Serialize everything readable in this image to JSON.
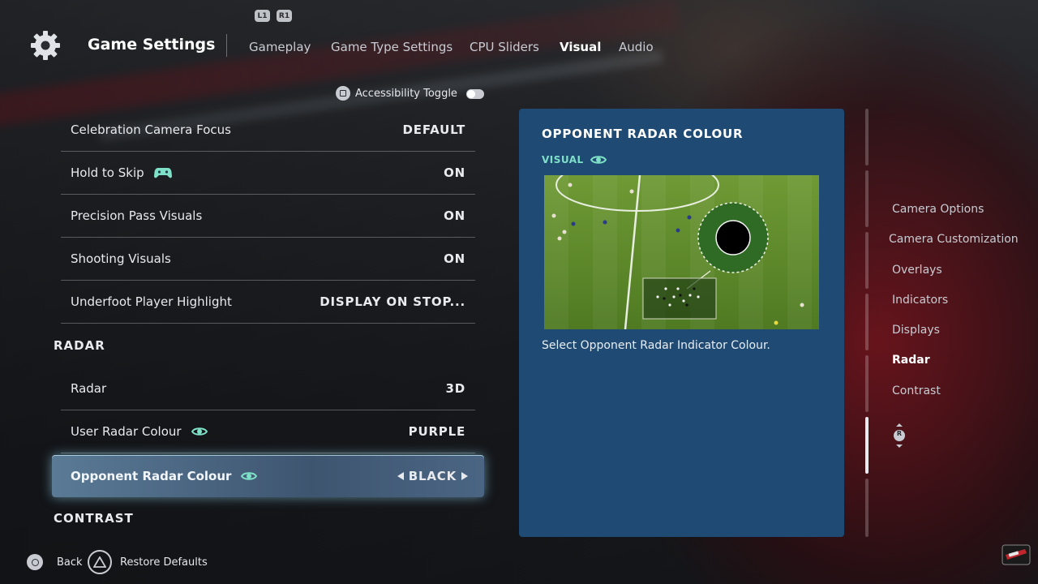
{
  "header": {
    "title": "Game Settings",
    "bumper_left": "L1",
    "bumper_right": "R1",
    "tabs": [
      {
        "label": "Gameplay",
        "active": false
      },
      {
        "label": "Game Type Settings",
        "active": false
      },
      {
        "label": "CPU Sliders",
        "active": false
      },
      {
        "label": "Visual",
        "active": true
      },
      {
        "label": "Audio",
        "active": false
      }
    ]
  },
  "accessibility_toggle": {
    "label": "Accessibility Toggle",
    "on": false
  },
  "settings": {
    "rows": [
      {
        "label": "Celebration Camera Focus",
        "value": "DEFAULT"
      },
      {
        "label": "Hold to Skip",
        "value": "ON",
        "icon": "gamepad-icon"
      },
      {
        "label": "Precision Pass Visuals",
        "value": "ON"
      },
      {
        "label": "Shooting Visuals",
        "value": "ON"
      },
      {
        "label": "Underfoot Player Highlight",
        "value": "DISPLAY ON STOP..."
      }
    ],
    "section_radar": "RADAR",
    "radar_rows": [
      {
        "label": "Radar",
        "value": "3D"
      },
      {
        "label": "User Radar Colour",
        "value": "PURPLE",
        "icon": "eye-icon"
      },
      {
        "label": "Opponent Radar Colour",
        "value": "BLACK",
        "icon": "eye-icon",
        "selected": true
      }
    ],
    "section_contrast": "CONTRAST"
  },
  "info_panel": {
    "title": "OPPONENT RADAR COLOUR",
    "tag": "VISUAL",
    "description": "Select Opponent Radar Indicator Colour.",
    "preview_color": "#000000"
  },
  "right_nav": {
    "items": [
      {
        "label": "Camera Options",
        "active": false
      },
      {
        "label": "Camera Customization",
        "active": false
      },
      {
        "label": "Overlays",
        "active": false
      },
      {
        "label": "Indicators",
        "active": false
      },
      {
        "label": "Displays",
        "active": false
      },
      {
        "label": "Radar",
        "active": true
      },
      {
        "label": "Contrast",
        "active": false
      }
    ],
    "stick_label": "R"
  },
  "footer": {
    "back": "Back",
    "restore": "Restore Defaults"
  },
  "colors": {
    "panel": "#1f4a73",
    "accent_teal": "#7fe0c8",
    "selected_row": "#4a6583"
  }
}
